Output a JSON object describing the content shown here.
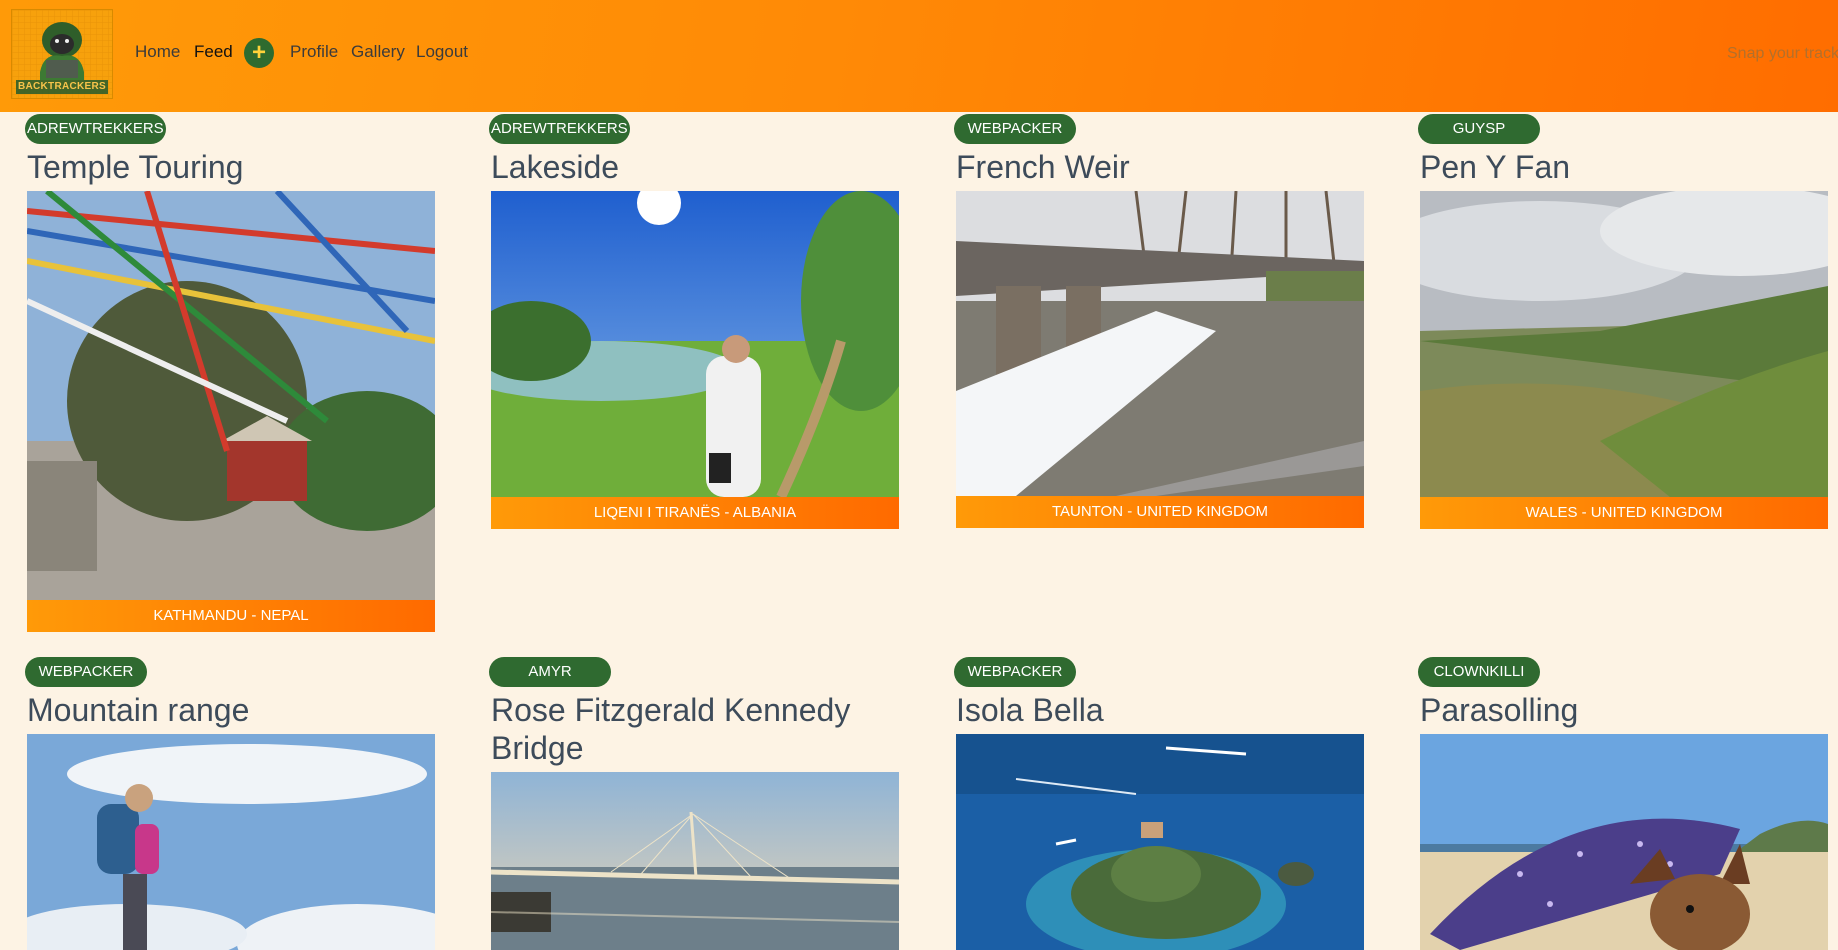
{
  "navbar": {
    "logo_text": "BACKTRACKERS",
    "links": [
      "Home",
      "Feed",
      "Profile",
      "Gallery",
      "Logout"
    ],
    "add_symbol": "+",
    "tagline": "Snap your track"
  },
  "posts": [
    {
      "user": "ADREWTREKKERS",
      "title": "Temple Touring",
      "location": "KATHMANDU - NEPAL",
      "photo_icon": "prayer-flags-temple"
    },
    {
      "user": "ADREWTREKKERS",
      "title": "Lakeside",
      "location": "LIQENI I TIRANËS - ALBANIA",
      "photo_icon": "lake-hiker"
    },
    {
      "user": "WEBPACKER",
      "title": "French Weir",
      "location": "TAUNTON - UNITED KINGDOM",
      "photo_icon": "weir-bridge"
    },
    {
      "user": "GUYSP",
      "title": "Pen Y Fan",
      "location": "WALES - UNITED KINGDOM",
      "photo_icon": "mountain-valley"
    },
    {
      "user": "WEBPACKER",
      "title": "Mountain range",
      "location": "",
      "photo_icon": "hiker-mountains"
    },
    {
      "user": "AMYR",
      "title": "Rose Fitzgerald Kennedy Bridge",
      "location": "",
      "photo_icon": "cable-bridge"
    },
    {
      "user": "WEBPACKER",
      "title": "Isola Bella",
      "location": "",
      "photo_icon": "island-sea"
    },
    {
      "user": "CLOWNKILLI",
      "title": "Parasolling",
      "location": "",
      "photo_icon": "beach-dog-parasol"
    }
  ],
  "colors": {
    "nav_gradient_start": "#ff9a08",
    "nav_gradient_end": "#ff6d00",
    "badge": "#2f6a30",
    "page_background": "#fdf3e4",
    "title_text": "#3d4b5a"
  }
}
